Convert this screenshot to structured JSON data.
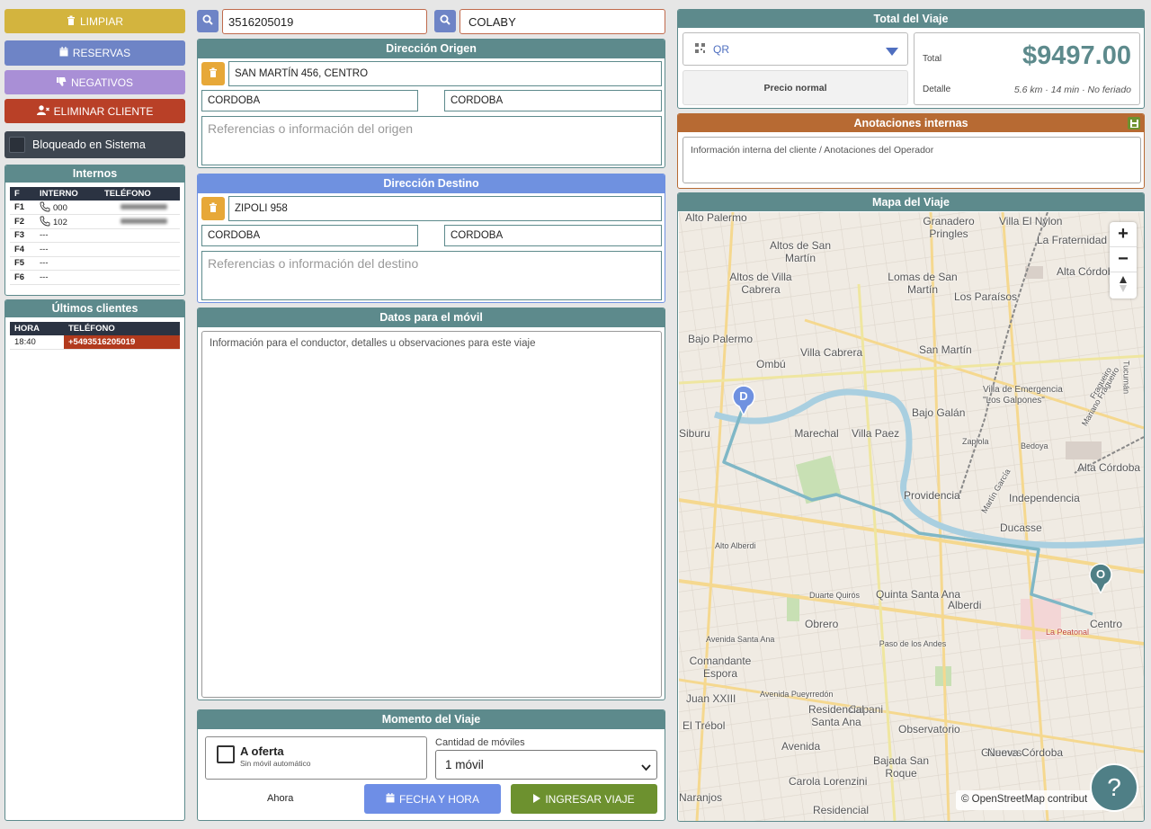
{
  "left": {
    "buttons": {
      "limpiar": "LIMPIAR",
      "reservas": "RESERVAS",
      "negativos": "NEGATIVOS",
      "eliminar": "ELIMINAR CLIENTE"
    },
    "bloqueado_label": "Bloqueado en Sistema",
    "internos": {
      "title": "Internos",
      "headers": [
        "F",
        "INTERNO",
        "TELÉFONO"
      ],
      "rows": [
        {
          "f": "F1",
          "interno": "000",
          "has_phone": true
        },
        {
          "f": "F2",
          "interno": "102",
          "has_phone": true
        },
        {
          "f": "F3",
          "interno": "---",
          "has_phone": false
        },
        {
          "f": "F4",
          "interno": "---",
          "has_phone": false
        },
        {
          "f": "F5",
          "interno": "---",
          "has_phone": false
        },
        {
          "f": "F6",
          "interno": "---",
          "has_phone": false
        }
      ]
    },
    "ultimos": {
      "title": "Últimos clientes",
      "headers": [
        "HORA",
        "TELÉFONO"
      ],
      "rows": [
        {
          "hora": "18:40",
          "telefono": "+5493516205019"
        }
      ]
    }
  },
  "middle": {
    "phone_value": "3516205019",
    "name_value": "COLABY",
    "origen": {
      "title": "Dirección Origen",
      "address": "SAN MARTÍN 456, CENTRO",
      "city1": "CORDOBA",
      "city2": "CORDOBA",
      "ref_placeholder": "Referencias o información del origen"
    },
    "destino": {
      "title": "Dirección Destino",
      "address": "ZIPOLI 958",
      "city1": "CORDOBA",
      "city2": "CORDOBA",
      "ref_placeholder": "Referencias o información del destino"
    },
    "movil": {
      "title": "Datos para el móvil",
      "placeholder": "Información para el conductor, detalles u observaciones para este viaje"
    },
    "momento": {
      "title": "Momento del Viaje",
      "oferta_label": "A oferta",
      "oferta_sub": "Sin móvil automático",
      "cantidad_label": "Cantidad de móviles",
      "cantidad_value": "1 móvil",
      "ahora": "Ahora",
      "fecha_btn": "FECHA Y HORA",
      "ingresar_btn": "INGRESAR VIAJE"
    }
  },
  "right": {
    "total": {
      "title": "Total del Viaje",
      "payment": "QR",
      "tarifa": "Precio normal",
      "total_label": "Total",
      "total_value": "$9497.00",
      "detalle_label": "Detalle",
      "detalle_value": "5.6 km · 14 min · No feriado"
    },
    "anotaciones": {
      "title": "Anotaciones internas",
      "placeholder": "Información interna del cliente / Anotaciones del Operador"
    },
    "mapa": {
      "title": "Mapa del Viaje",
      "zoom_in": "+",
      "zoom_out": "−",
      "attribution": "© OpenStreetMap contribut",
      "help": "?",
      "marker_origin": "O",
      "marker_dest": "D",
      "labels": [
        "Alto Palermo",
        "Granadero Pringles",
        "Villa El Nylon",
        "La Fraternidad",
        "Altos de San Martín",
        "Alta Córdoba",
        "Altos de Villa Cabrera",
        "Lomas de San Martín",
        "Los Paraísos",
        "Bajo Palermo",
        "Villa Cabrera",
        "San Martín",
        "Ombú",
        "Villa de Emergencia \"Los Galpones\"",
        "Bajo Galán",
        "Marechal",
        "Villa Paez",
        "Siburu",
        "Providencia",
        "Independencia",
        "Alta Córdoba",
        "Ducasse",
        "Alto Alberdi",
        "Quinta Santa Ana",
        "Alberdi",
        "Obrero",
        "Centro",
        "Paso de los Andes",
        "Comandante Espora",
        "La Peatonal",
        "Juan XXIII",
        "Cupani",
        "Residencial Santa Ana",
        "El Trébol",
        "Observatorio",
        "Avenida",
        "Güemes",
        "Nueva Córdoba",
        "Bajada San Roque",
        "Carola Lorenzini",
        "Naranjos",
        "Residencial",
        "Tucumán",
        "Duarte Quirós",
        "Avenida Santa Ana",
        "Avenida Pueyrredón",
        "Bedoya",
        "Zapiola",
        "Fragueiro",
        "Mariano Fragueiro",
        "Martín García"
      ]
    }
  },
  "colors": {
    "teal": "#5d8a8c",
    "limpiar": "#d3b43e",
    "reservas": "#6e84c6",
    "negativos": "#a98fd6",
    "eliminar": "#b94027",
    "bloqueado": "#3e4650",
    "destino_header": "#6f91e0",
    "anotaciones_header": "#b76a33",
    "ingresar": "#6d912f",
    "total_value": "#5d8a8c",
    "route": "#7fb7c6"
  }
}
